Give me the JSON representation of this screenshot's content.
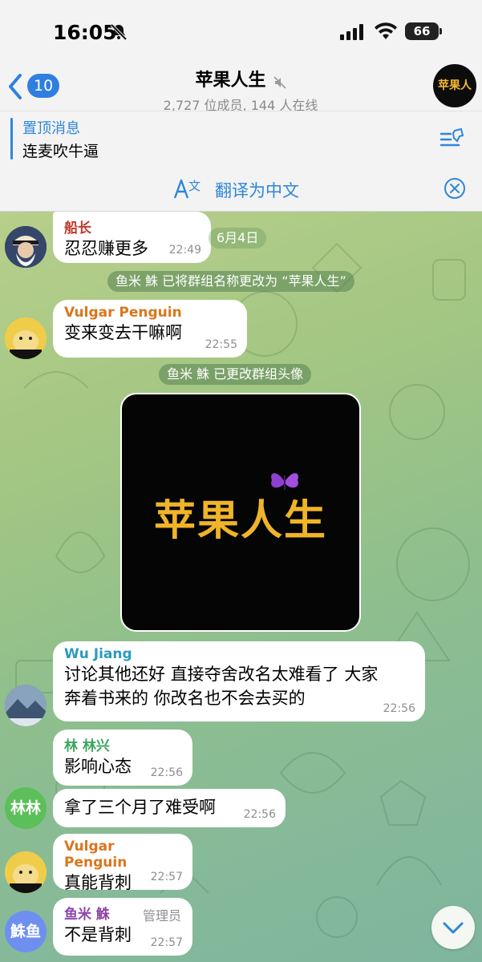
{
  "status_bar": {
    "time": "16:05",
    "battery": "66"
  },
  "header": {
    "back_count": "10",
    "title": "苹果人生",
    "subtitle": "2,727 位成员, 144 人在线",
    "avatar_text": "苹果人生"
  },
  "pinned": {
    "label": "置顶消息",
    "text": "连麦吹牛逼"
  },
  "translate_bar": {
    "label": "翻译为中文"
  },
  "date_chip": "6月4日",
  "messages": [
    {
      "sender": "船长",
      "sender_color": "#c0392b",
      "text": "忍忍赚更多",
      "time": "22:49"
    },
    {
      "service": "鱼米 鮢 已将群组名称更改为 “苹果人生”"
    },
    {
      "sender": "Vulgar Penguin",
      "sender_color": "#d9761c",
      "text": "变来变去干嘛啊",
      "time": "22:55"
    },
    {
      "service": "鱼米 鮢 已更改群组头像"
    },
    {
      "image_title": "苹果人生"
    },
    {
      "sender": "Wu Jiang",
      "sender_color": "#2a9bbf",
      "line1": "讨论其他还好 直接夺舍改名太难看了 大家",
      "line2": "奔着书来的 你改名也不会去买的",
      "time": "22:56"
    },
    {
      "sender": "林 林兴",
      "sender_color": "#3ba55c",
      "text": "影响心态",
      "time": "22:56",
      "avatar_letters": "林林"
    },
    {
      "text": "拿了三个月了难受啊",
      "time": "22:56"
    },
    {
      "sender": "Vulgar Penguin",
      "sender_color": "#d9761c",
      "text": "真能背刺",
      "time": "22:57"
    },
    {
      "sender": "鱼米 鮢",
      "sender_color": "#8e44ad",
      "role": "管理员",
      "text": "不是背刺",
      "time": "22:57",
      "avatar_letters": "鮢鱼"
    }
  ]
}
